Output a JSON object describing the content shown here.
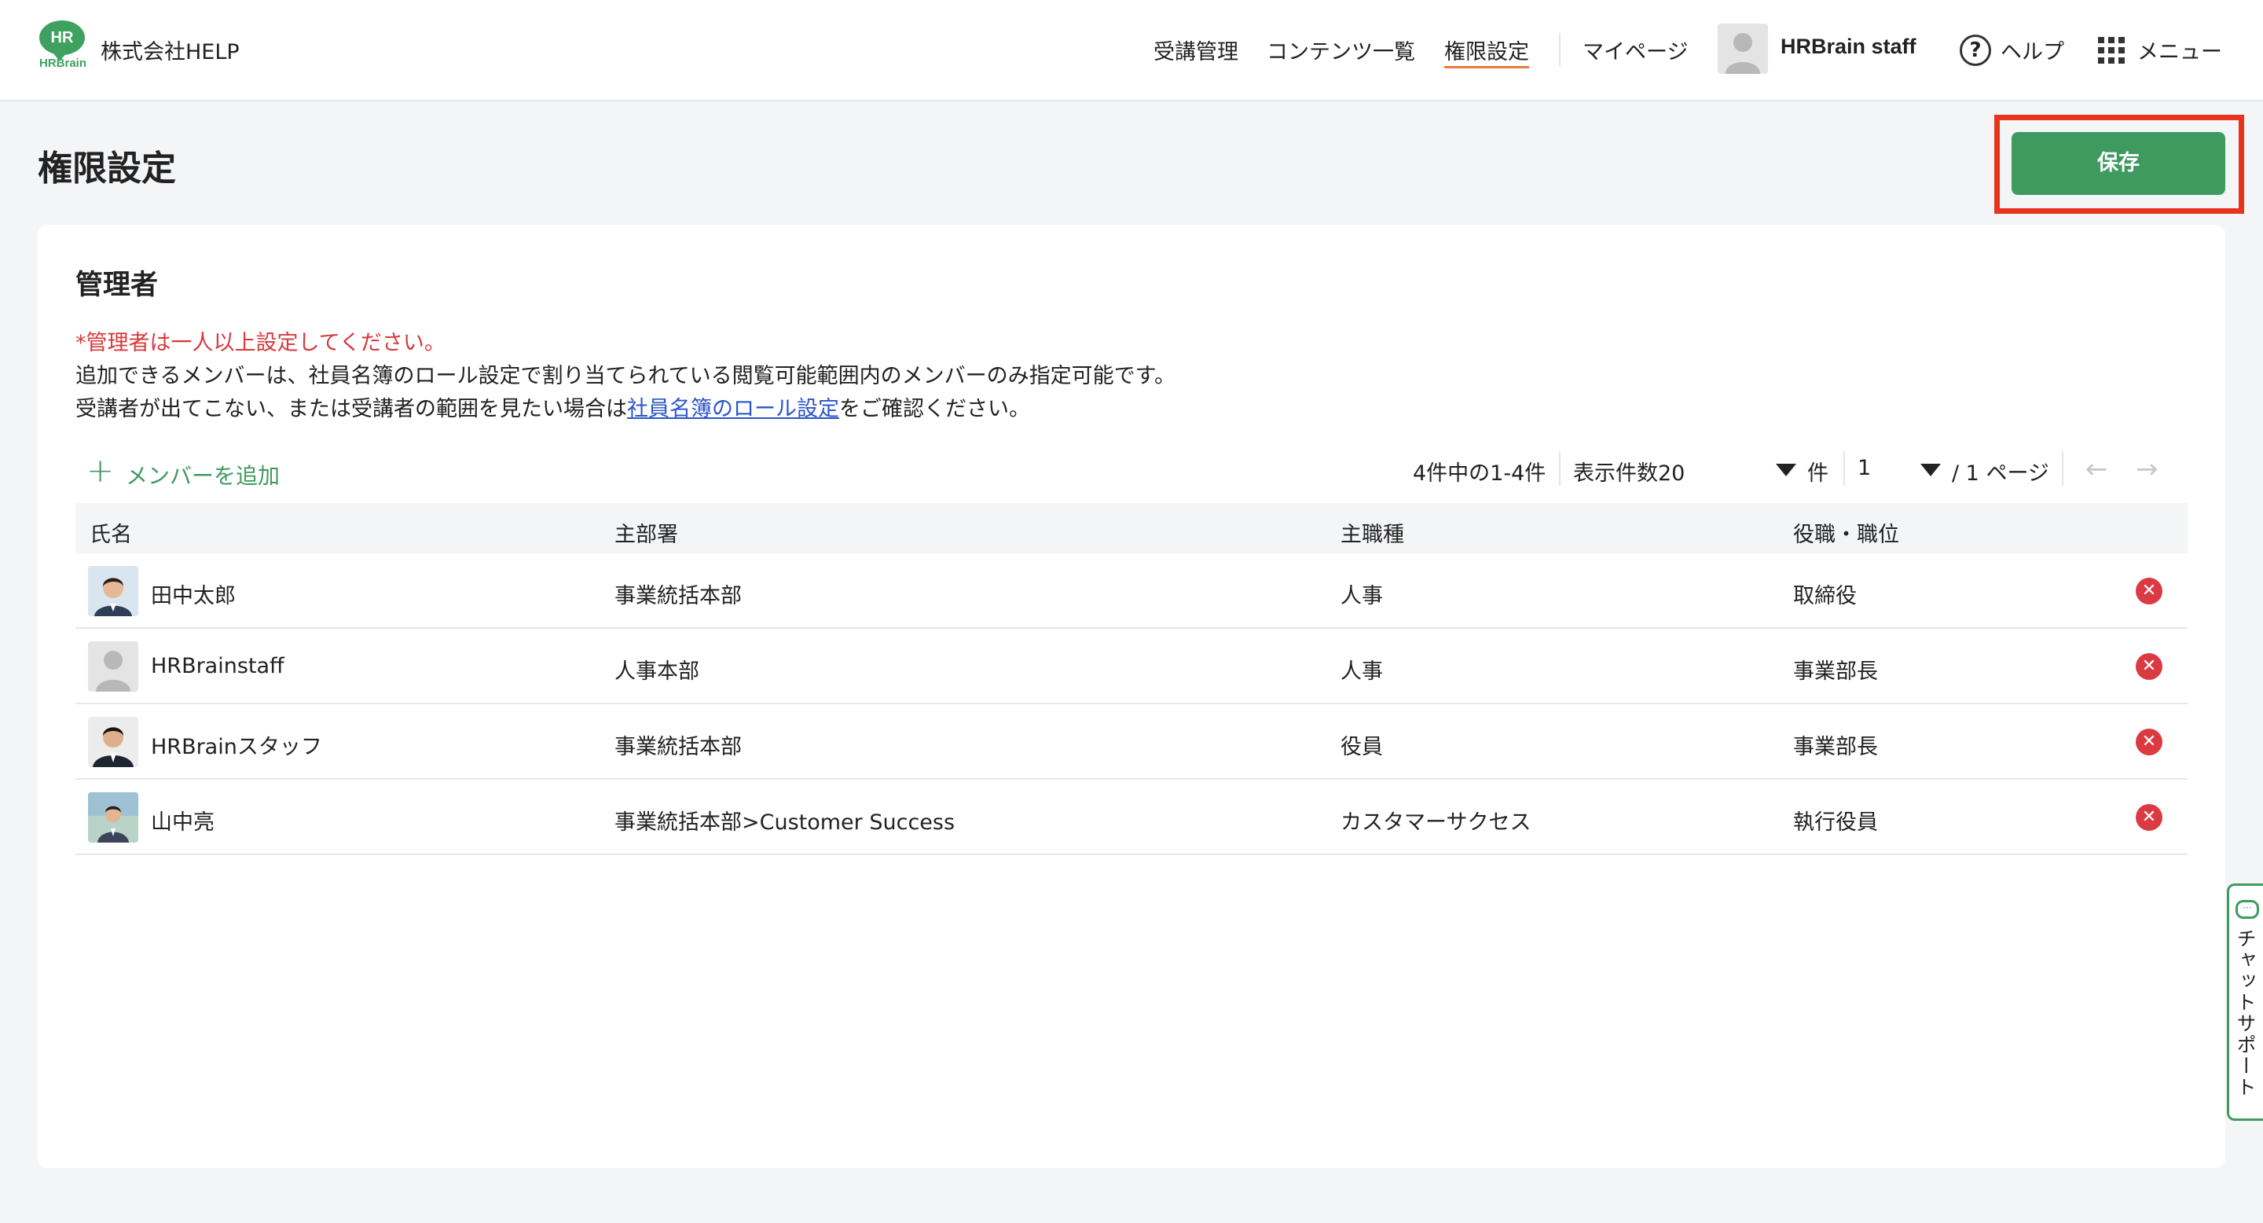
{
  "header": {
    "logo_mark": "HR",
    "logo_text": "HRBrain",
    "company": "株式会社HELP",
    "nav": [
      {
        "label": "受講管理"
      },
      {
        "label": "コンテンツ一覧"
      },
      {
        "label": "権限設定",
        "active": true
      },
      {
        "label": "マイページ"
      }
    ],
    "user_name": "HRBrain staff",
    "help_label": "ヘルプ",
    "menu_label": "メニュー",
    "accent_color": "#e57a3a"
  },
  "page": {
    "title": "権限設定",
    "save_label": "保存",
    "save_color": "#3f9a5f",
    "highlight_color": "#e8341c"
  },
  "section": {
    "title": "管理者",
    "warning": "*管理者は一人以上設定してください。",
    "note1": "追加できるメンバーは、社員名簿のロール設定で割り当てられている閲覧可能範囲内のメンバーのみ指定可能です。",
    "note2_prefix": "受講者が出てこない、または受講者の範囲を見たい場合は",
    "note2_link": "社員名簿のロール設定",
    "note2_suffix": "をご確認ください。",
    "add_member_label": "メンバーを追加"
  },
  "pagination": {
    "count_text": "4件中の1-4件",
    "per_page_text": "表示件数20",
    "per_page_unit": "件",
    "current_page": "1",
    "total_pages_text": "/ 1 ページ"
  },
  "table": {
    "headers": [
      "氏名",
      "主部署",
      "主職種",
      "役職・職位"
    ],
    "rows": [
      {
        "name": "田中太郎",
        "dept": "事業統括本部",
        "job": "人事",
        "position": "取締役",
        "avatar": "photo"
      },
      {
        "name": "HRBrainstaff",
        "dept": "人事本部",
        "job": "人事",
        "position": "事業部長",
        "avatar": "placeholder"
      },
      {
        "name": "HRBrainスタッフ",
        "dept": "事業統括本部",
        "job": "役員",
        "position": "事業部長",
        "avatar": "photo"
      },
      {
        "name": "山中亮",
        "dept": "事業統括本部>Customer Success",
        "job": "カスタマーサクセス",
        "position": "執行役員",
        "avatar": "photo"
      }
    ]
  },
  "chat": {
    "label": "チャットサポート"
  }
}
